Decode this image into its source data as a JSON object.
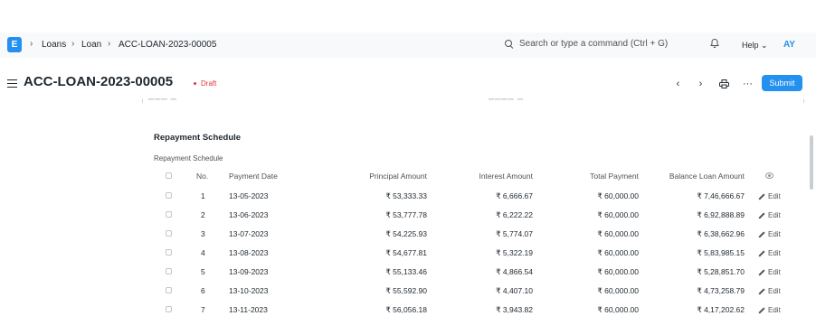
{
  "navbar": {
    "logo": "E",
    "breadcrumbs": [
      "Loans",
      "Loan",
      "ACC-LOAN-2023-00005"
    ],
    "search_placeholder": "Search or type a command (Ctrl + G)",
    "help": "Help",
    "avatar": "AY"
  },
  "page": {
    "title": "ACC-LOAN-2023-00005",
    "status": "Draft",
    "submit": "Submit"
  },
  "section": {
    "title": "Repayment Schedule",
    "table_label": "Repayment Schedule"
  },
  "table": {
    "headers": [
      "No.",
      "Payment Date",
      "Principal Amount",
      "Interest Amount",
      "Total Payment",
      "Balance Loan Amount"
    ],
    "edit_label": "Edit",
    "rows": [
      {
        "no": "1",
        "date": "13-05-2023",
        "principal": "₹ 53,333.33",
        "interest": "₹ 6,666.67",
        "total": "₹ 60,000.00",
        "balance": "₹ 7,46,666.67"
      },
      {
        "no": "2",
        "date": "13-06-2023",
        "principal": "₹ 53,777.78",
        "interest": "₹ 6,222.22",
        "total": "₹ 60,000.00",
        "balance": "₹ 6,92,888.89"
      },
      {
        "no": "3",
        "date": "13-07-2023",
        "principal": "₹ 54,225.93",
        "interest": "₹ 5,774.07",
        "total": "₹ 60,000.00",
        "balance": "₹ 6,38,662.96"
      },
      {
        "no": "4",
        "date": "13-08-2023",
        "principal": "₹ 54,677.81",
        "interest": "₹ 5,322.19",
        "total": "₹ 60,000.00",
        "balance": "₹ 5,83,985.15"
      },
      {
        "no": "5",
        "date": "13-09-2023",
        "principal": "₹ 55,133.46",
        "interest": "₹ 4,866.54",
        "total": "₹ 60,000.00",
        "balance": "₹ 5,28,851.70"
      },
      {
        "no": "6",
        "date": "13-10-2023",
        "principal": "₹ 55,592.90",
        "interest": "₹ 4,407.10",
        "total": "₹ 60,000.00",
        "balance": "₹ 4,73,258.79"
      },
      {
        "no": "7",
        "date": "13-11-2023",
        "principal": "₹ 56,056.18",
        "interest": "₹ 3,943.82",
        "total": "₹ 60,000.00",
        "balance": "₹ 4,17,202.62"
      }
    ]
  }
}
